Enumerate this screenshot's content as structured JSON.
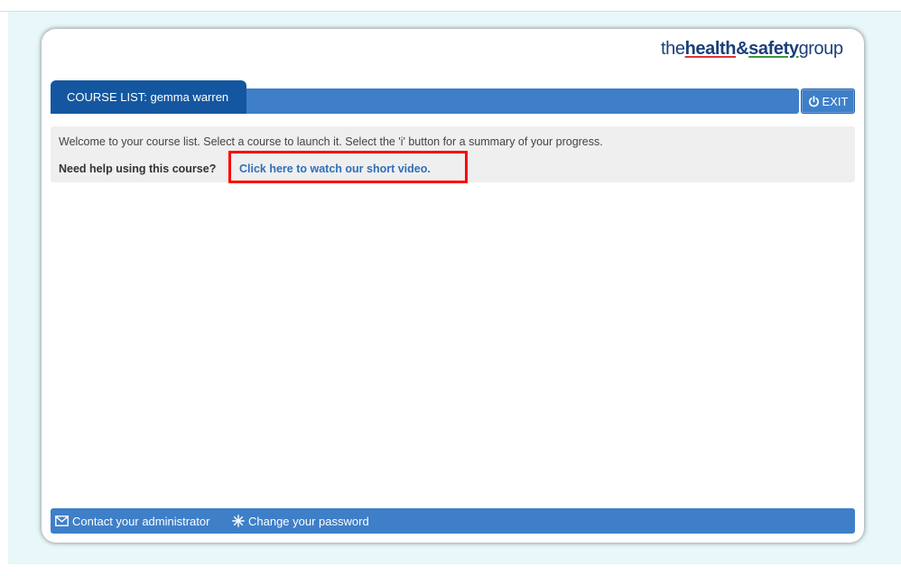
{
  "brand": {
    "part1": "the",
    "part2": "health",
    "part3": "&",
    "part4": "safety",
    "part5": "group"
  },
  "header": {
    "course_tab_label": "COURSE LIST: gemma warren",
    "exit_label": "EXIT",
    "exit_icon": "power-icon"
  },
  "welcome": {
    "message": "Welcome to your course list. Select a course to launch it. Select the 'i' button for a summary of your progress.",
    "help_label": "Need help using this course?",
    "help_link": "Click here to watch our short video."
  },
  "footer": {
    "contact_label": "Contact your administrator",
    "contact_icon": "envelope-icon",
    "password_label": "Change your password",
    "password_icon": "asterisk-icon"
  },
  "colors": {
    "nav_blue": "#3e7fc8",
    "tab_dark_blue": "#1457a0",
    "link_blue": "#2f6fb8",
    "highlight_red": "#ff0000",
    "backdrop": "#e8f7f9"
  }
}
